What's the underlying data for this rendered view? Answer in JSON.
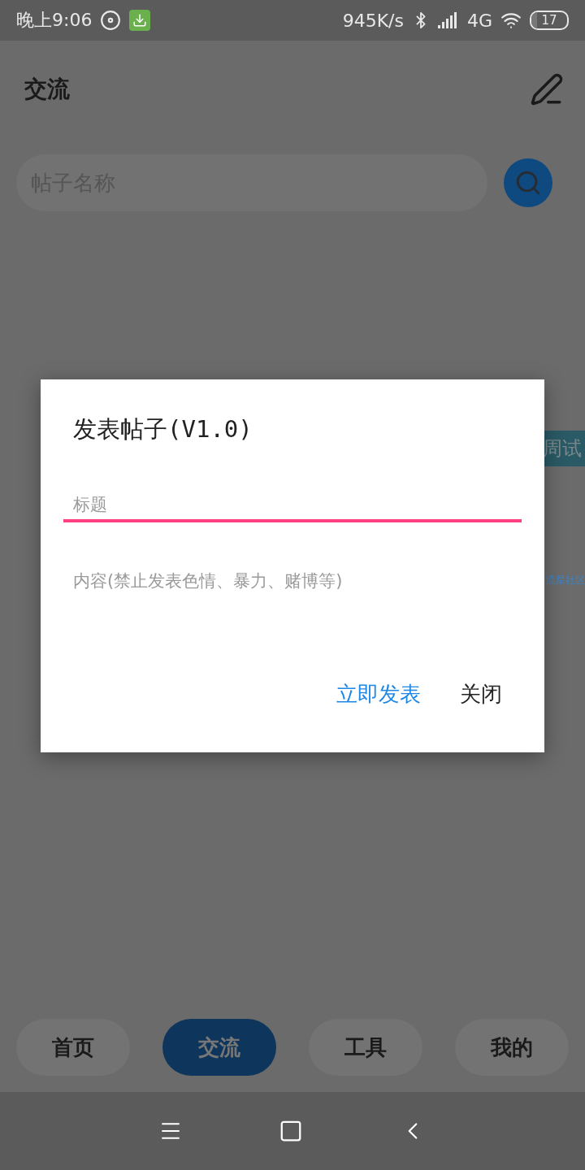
{
  "status_bar": {
    "time": "晚上9:06",
    "speed": "945K/s",
    "network": "4G",
    "battery": {
      "text": "17",
      "level": 0.17
    }
  },
  "header": {
    "title": "交流"
  },
  "search": {
    "placeholder": "帖子名称"
  },
  "background_items": [
    {
      "kind": "tag",
      "text": "周试"
    },
    {
      "kind": "link",
      "text": "流星社区"
    }
  ],
  "dialog": {
    "title": "发表帖子(V1.0)",
    "title_field": {
      "placeholder": "标题",
      "focused": true
    },
    "content_field": {
      "placeholder": "内容(禁止发表色情、暴力、赌博等)"
    },
    "buttons": [
      {
        "label": "立即发表",
        "kind": "primary"
      },
      {
        "label": "关闭",
        "kind": "plain"
      }
    ]
  },
  "tabs": [
    {
      "label": "首页",
      "selected": false
    },
    {
      "label": "交流",
      "selected": true
    },
    {
      "label": "工具",
      "selected": false
    },
    {
      "label": "我的",
      "selected": false
    }
  ]
}
